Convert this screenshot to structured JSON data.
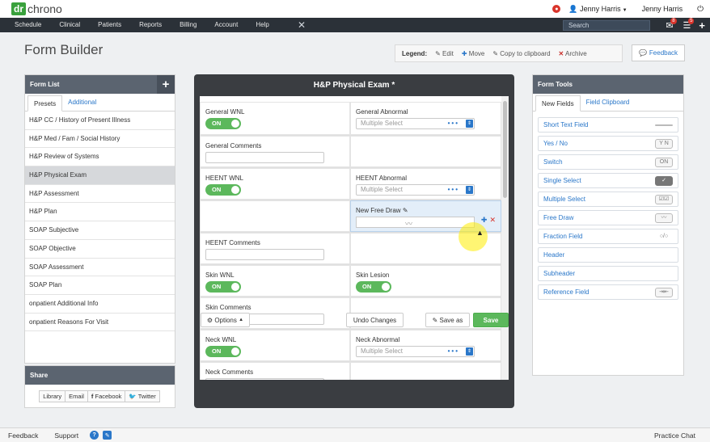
{
  "logo": {
    "prefix": "dr",
    "name": "chrono"
  },
  "topbar": {
    "user_menu": "Jenny Harris",
    "user_name": "Jenny Harris",
    "power_icon": "power-icon",
    "alert_icon": "alert-icon"
  },
  "nav": {
    "items": [
      "Schedule",
      "Clinical",
      "Patients",
      "Reports",
      "Billing",
      "Account",
      "Help"
    ],
    "search_placeholder": "Search",
    "mail_badge": "8",
    "list_badge": "5"
  },
  "page": {
    "title": "Form Builder"
  },
  "legend": {
    "label": "Legend:",
    "edit": "Edit",
    "move": "Move",
    "copy": "Copy to clipboard",
    "archive": "Archive"
  },
  "feedback_label": "Feedback",
  "form_list": {
    "title": "Form List",
    "tabs": [
      "Presets",
      "Additional"
    ],
    "items": [
      "H&P CC / History of Present Illness",
      "H&P Med / Fam / Social History",
      "H&P Review of Systems",
      "H&P Physical Exam",
      "H&P Assessment",
      "H&P Plan",
      "SOAP Subjective",
      "SOAP Objective",
      "SOAP Assessment",
      "SOAP Plan",
      "onpatient Additional Info",
      "onpatient Reasons For Visit"
    ],
    "active_index": 3
  },
  "share": {
    "title": "Share",
    "buttons": [
      "Library",
      "Email",
      "Facebook",
      "Twitter"
    ]
  },
  "builder": {
    "title": "H&P Physical Exam *",
    "fields": {
      "general_wnl": "General WNL",
      "general_abnormal": "General Abnormal",
      "general_comments": "General Comments",
      "heent_wnl": "HEENT WNL",
      "heent_abnormal": "HEENT Abnormal",
      "new_free_draw": "New Free Draw",
      "heent_comments": "HEENT Comments",
      "skin_wnl": "Skin WNL",
      "skin_lesion": "Skin Lesion",
      "skin_comments": "Skin Comments",
      "neck_wnl": "Neck WNL",
      "neck_abnormal": "Neck Abnormal",
      "neck_comments": "Neck Comments"
    },
    "toggle_on": "ON",
    "multiselect_placeholder": "Multiple Select",
    "buttons": {
      "options": "Options",
      "undo": "Undo Changes",
      "save_as": "Save as",
      "save": "Save"
    }
  },
  "form_tools": {
    "title": "Form Tools",
    "tabs": [
      "New Fields",
      "Field Clipboard"
    ],
    "tools": [
      {
        "label": "Short Text Field",
        "icon": ""
      },
      {
        "label": "Yes / No",
        "icon": "Y N"
      },
      {
        "label": "Switch",
        "icon": "ON"
      },
      {
        "label": "Single Select",
        "icon": "✓"
      },
      {
        "label": "Multiple Select",
        "icon": "☑☑"
      },
      {
        "label": "Free Draw",
        "icon": "〰"
      },
      {
        "label": "Fraction Field",
        "icon": "○/○"
      },
      {
        "label": "Header",
        "icon": ""
      },
      {
        "label": "Subheader",
        "icon": ""
      },
      {
        "label": "Reference Field",
        "icon": "⇥⇤"
      }
    ]
  },
  "bottombar": {
    "feedback": "Feedback",
    "support": "Support",
    "practice_chat": "Practice Chat"
  }
}
